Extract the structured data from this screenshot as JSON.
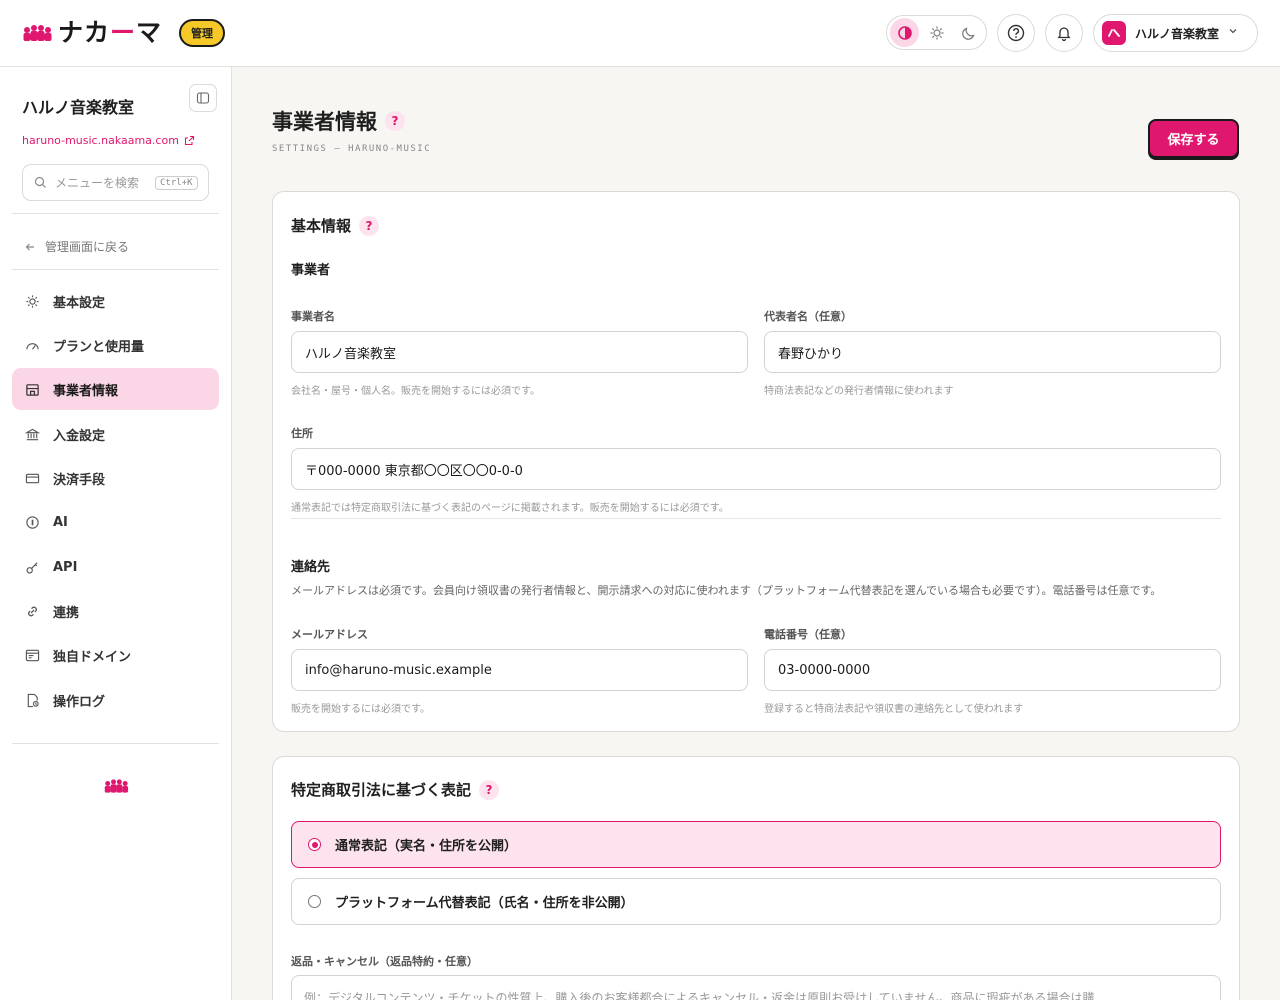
{
  "header": {
    "logo_text_a": "ナカ",
    "logo_text_bar": "ー",
    "logo_text_b": "マ",
    "admin_badge": "管理",
    "account_name": "ハルノ音楽教室"
  },
  "sidebar": {
    "title": "ハルノ音楽教室",
    "site_link": "haruno-music.nakaama.com",
    "search_placeholder": "メニューを検索",
    "search_shortcut": "Ctrl+K",
    "back_label": "管理画面に戻る",
    "items": [
      {
        "label": "基本設定",
        "icon": "sun-icon"
      },
      {
        "label": "プランと使用量",
        "icon": "gauge-icon"
      },
      {
        "label": "事業者情報",
        "icon": "store-icon",
        "active": true
      },
      {
        "label": "入金設定",
        "icon": "bank-icon"
      },
      {
        "label": "決済手段",
        "icon": "credit-card-icon"
      },
      {
        "label": "AI",
        "icon": "ai-icon"
      },
      {
        "label": "API",
        "icon": "key-icon"
      },
      {
        "label": "連携",
        "icon": "link-icon"
      },
      {
        "label": "独自ドメイン",
        "icon": "domain-icon"
      },
      {
        "label": "操作ログ",
        "icon": "log-icon"
      }
    ]
  },
  "main": {
    "title": "事業者情報",
    "subtitle": "SETTINGS — HARUNO-MUSIC",
    "save_label": "保存する"
  },
  "basic": {
    "title": "基本情報",
    "business_section": "事業者",
    "name_label": "事業者名",
    "name_value": "ハルノ音楽教室",
    "name_hint": "会社名・屋号・個人名。販売を開始するには必須です。",
    "rep_label": "代表者名（任意）",
    "rep_value": "春野ひかり",
    "rep_hint": "特商法表記などの発行者情報に使われます",
    "address_label": "住所",
    "address_value": "〒000-0000 東京都〇〇区〇〇0-0-0",
    "address_hint": "通常表記では特定商取引法に基づく表記のページに掲載されます。販売を開始するには必須です。",
    "contact_section": "連絡先",
    "contact_desc": "メールアドレスは必須です。会員向け領収書の発行者情報と、開示請求への対応に使われます（プラットフォーム代替表記を選んでいる場合も必要です）。電話番号は任意です。",
    "email_label": "メールアドレス",
    "email_value": "info@haruno-music.example",
    "email_hint": "販売を開始するには必須です。",
    "phone_label": "電話番号（任意）",
    "phone_value": "03-0000-0000",
    "phone_hint": "登録すると特商法表記や領収書の連絡先として使われます"
  },
  "legal": {
    "title": "特定商取引法に基づく表記",
    "option_normal": "通常表記（実名・住所を公開）",
    "option_platform": "プラットフォーム代替表記（氏名・住所を非公開）",
    "selected": "normal",
    "returns_label": "返品・キャンセル（返品特約・任意）",
    "returns_placeholder": "例：デジタルコンテンツ・チケットの性質上、購入後のお客様都合によるキャンセル・返金は原則お受けしていません。商品に瑕疵がある場合は購"
  },
  "colors": {
    "accent": "#e0176e",
    "accent_soft": "#fbd6e6",
    "badge": "#f7c928"
  }
}
